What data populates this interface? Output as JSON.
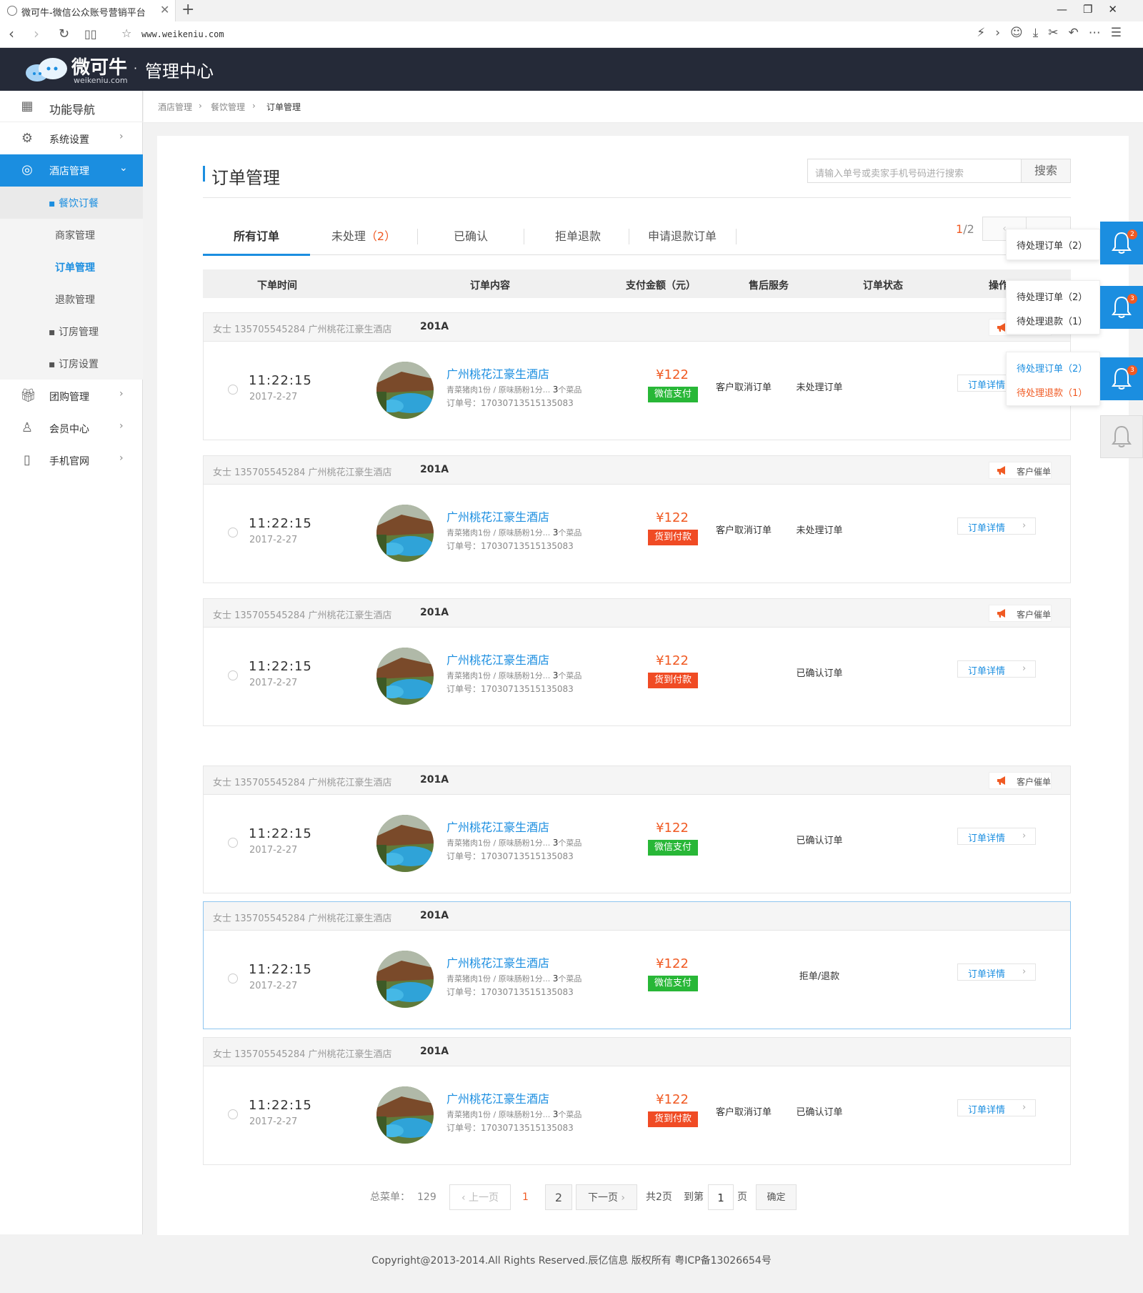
{
  "browser": {
    "tab_title": "微可牛-微信公众账号营销平台",
    "url": "www.weikeniu.com"
  },
  "header": {
    "logo_main": "微可牛",
    "logo_sub": "weikeniu.com",
    "logo_dot": "·",
    "center": "管理中心"
  },
  "sidebar": {
    "title": "功能导航",
    "items": [
      {
        "label": "系统设置",
        "icon": "gear-icon"
      },
      {
        "label": "酒店管理",
        "icon": "hotel-icon"
      },
      {
        "label": "团购管理",
        "icon": "gift-icon"
      },
      {
        "label": "会员中心",
        "icon": "vip-user-icon"
      },
      {
        "label": "手机官网",
        "icon": "mobile-icon"
      }
    ],
    "sub_dining": "▪ 餐饮订餐",
    "sub_merchant": "商家管理",
    "sub_orders": "订单管理",
    "sub_refund": "退款管理",
    "sub_room_manage": "▪ 订房管理",
    "sub_room_settings": "▪ 订房设置"
  },
  "breadcrumb": [
    "酒店管理",
    "餐饮管理",
    "订单管理"
  ],
  "page_title": "订单管理",
  "search": {
    "placeholder": "请输入单号或卖家手机号码进行搜索",
    "button": "搜索"
  },
  "tabs": {
    "all": "所有订单",
    "pending": "未处理",
    "pending_count": "（2）",
    "confirmed": "已确认",
    "refused": "拒单退款",
    "refund_apply": "申请退款订单"
  },
  "page_indicator": {
    "current": "1",
    "total": "/2"
  },
  "table_headers": [
    "下单时间",
    "订单内容",
    "支付金额（元）",
    "售后服务",
    "订单状态",
    "操作"
  ],
  "orders": [
    {
      "customer": "女士  135705545284   广州桃花江豪生酒店",
      "room": "201A",
      "urge": "客户催单",
      "time": "11:22:15",
      "date": "2017-2-27",
      "hotel": "广州桃花江豪生酒店",
      "items": "青菜猪肉1份 / 原味肠粉1分...",
      "count": "3",
      "count_unit": "个菜品",
      "order_no": "订单号：17030713515135083",
      "price": "¥122",
      "pay": "微信支付",
      "pay_color": "#28b737",
      "after": "客户取消订单",
      "status": "未处理订单",
      "detail": "订单详情"
    },
    {
      "customer": "女士  135705545284   广州桃花江豪生酒店",
      "room": "201A",
      "urge": "客户催单",
      "time": "11:22:15",
      "date": "2017-2-27",
      "hotel": "广州桃花江豪生酒店",
      "items": "青菜猪肉1份 / 原味肠粉1分...",
      "count": "3",
      "count_unit": "个菜品",
      "order_no": "订单号：17030713515135083",
      "price": "¥122",
      "pay": "货到付款",
      "pay_color": "#f04b24",
      "after": "客户取消订单",
      "status": "未处理订单",
      "detail": "订单详情"
    },
    {
      "customer": "女士  135705545284   广州桃花江豪生酒店",
      "room": "201A",
      "urge": "客户催单",
      "time": "11:22:15",
      "date": "2017-2-27",
      "hotel": "广州桃花江豪生酒店",
      "items": "青菜猪肉1份 / 原味肠粉1分...",
      "count": "3",
      "count_unit": "个菜品",
      "order_no": "订单号：17030713515135083",
      "price": "¥122",
      "pay": "货到付款",
      "pay_color": "#f04b24",
      "after": "",
      "status": "已确认订单",
      "detail": "订单详情"
    },
    {
      "customer": "女士  135705545284   广州桃花江豪生酒店",
      "room": "201A",
      "urge": "客户催单",
      "time": "11:22:15",
      "date": "2017-2-27",
      "hotel": "广州桃花江豪生酒店",
      "items": "青菜猪肉1份 / 原味肠粉1分...",
      "count": "3",
      "count_unit": "个菜品",
      "order_no": "订单号：17030713515135083",
      "price": "¥122",
      "pay": "微信支付",
      "pay_color": "#28b737",
      "after": "",
      "status": "已确认订单",
      "detail": "订单详情"
    },
    {
      "customer": "女士  135705545284   广州桃花江豪生酒店",
      "room": "201A",
      "urge": "",
      "time": "11:22:15",
      "date": "2017-2-27",
      "hotel": "广州桃花江豪生酒店",
      "items": "青菜猪肉1份 / 原味肠粉1分...",
      "count": "3",
      "count_unit": "个菜品",
      "order_no": "订单号：17030713515135083",
      "price": "¥122",
      "pay": "微信支付",
      "pay_color": "#28b737",
      "after": "",
      "status": "拒单/退款",
      "detail": "订单详情"
    },
    {
      "customer": "女士  135705545284   广州桃花江豪生酒店",
      "room": "201A",
      "urge": "",
      "time": "11:22:15",
      "date": "2017-2-27",
      "hotel": "广州桃花江豪生酒店",
      "items": "青菜猪肉1份 / 原味肠粉1分...",
      "count": "3",
      "count_unit": "个菜品",
      "order_no": "订单号：17030713515135083",
      "price": "¥122",
      "pay": "货到付款",
      "pay_color": "#f04b24",
      "after": "客户取消订单",
      "status": "已确认订单",
      "detail": "订单详情"
    }
  ],
  "pager": {
    "total_label": "总菜单：",
    "total": "129",
    "prev": "上一页",
    "p1": "1",
    "p2": "2",
    "next": "下一页",
    "pages_total": "共2页",
    "goto": "到第",
    "goto_value": "1",
    "page_unit": "页",
    "confirm": "确定"
  },
  "notifications": {
    "n1_line1": "待处理订单（2）",
    "n1_badge": "2",
    "n2_line1": "待处理订单（2）",
    "n2_line2": "待处理退款（1）",
    "n2_badge": "3",
    "n3_line1": "待处理订单（2）",
    "n3_line2": "待处理退款（1）",
    "n3_badge": "3"
  },
  "footer": "Copyright@2013-2014.All Rights Reserved.辰亿信息 版权所有 粤ICP备13026654号",
  "colors": {
    "accent": "#1b8ee0",
    "header_bg": "#252a38",
    "price": "#f05a23",
    "wechat_pay": "#28b737",
    "cod_pay": "#f04b24"
  }
}
